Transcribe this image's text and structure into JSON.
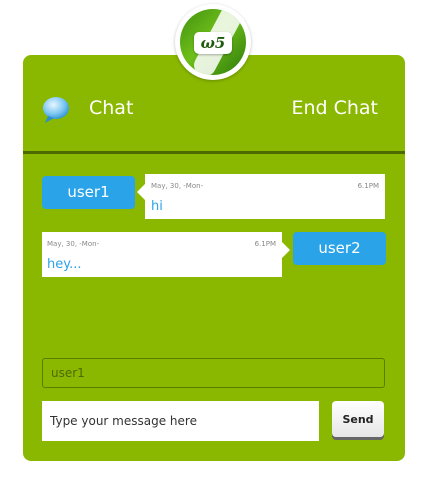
{
  "logo": {
    "text": "ω5"
  },
  "header": {
    "title": "Chat",
    "end_label": "End Chat",
    "icon": "chat-bubble-icon"
  },
  "messages": [
    {
      "user": "user1",
      "date": "May, 30,  -Mon-",
      "time": "6.1PM",
      "text": "hi"
    },
    {
      "user": "user2",
      "date": "May, 30,  -Mon-",
      "time": "6.1PM",
      "text": "hey..."
    }
  ],
  "composer": {
    "name_placeholder": "user1",
    "message_placeholder": "Type your message here",
    "send_label": "Send"
  },
  "colors": {
    "panel": "#8ab800",
    "accent": "#2aa3e8",
    "divider": "#4d6a00"
  }
}
